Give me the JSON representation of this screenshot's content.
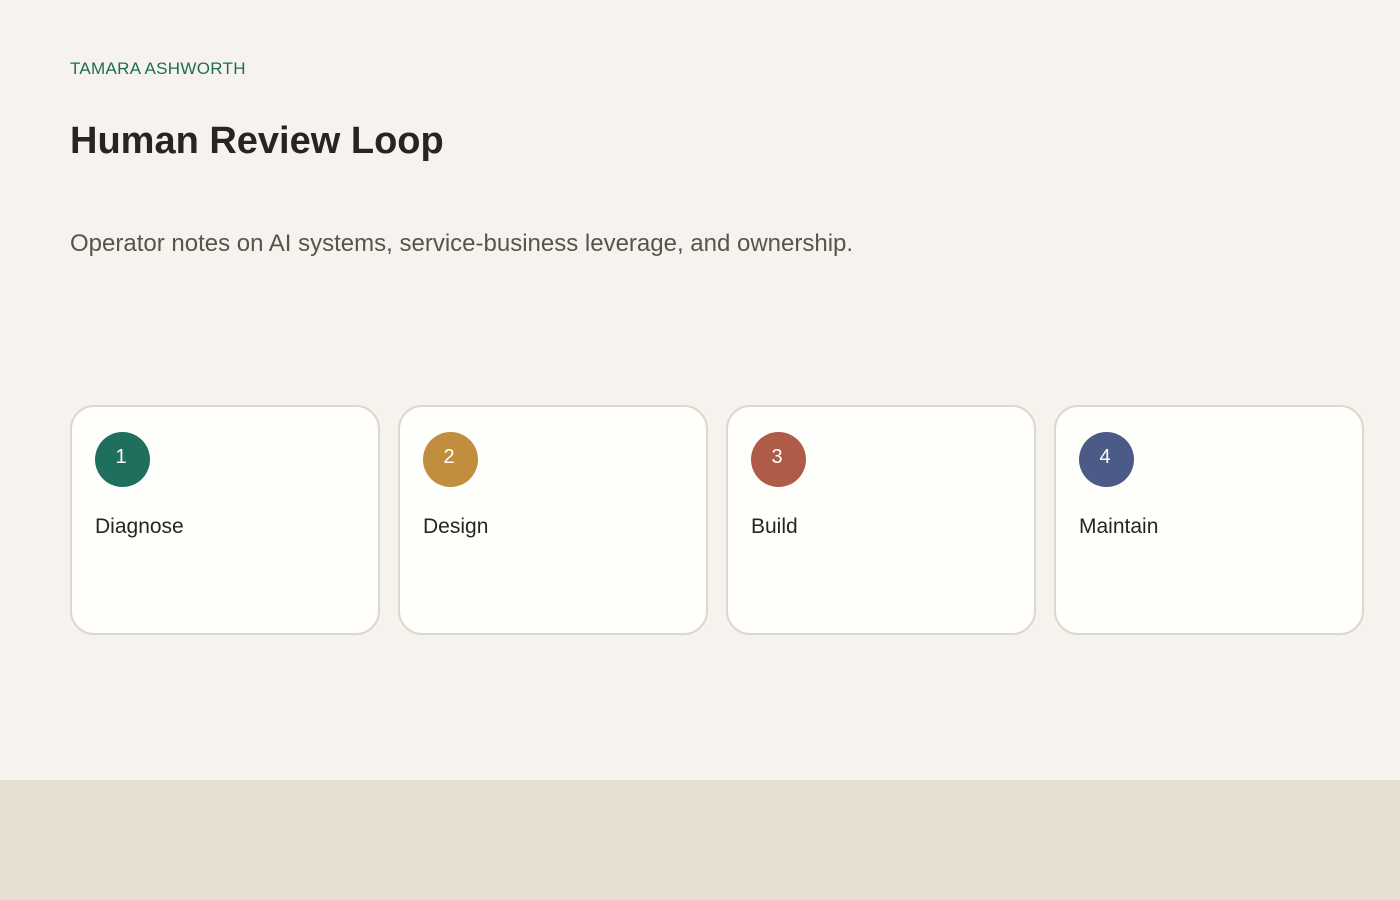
{
  "header": {
    "author": "TAMARA ASHWORTH",
    "title": "Human Review Loop",
    "subtitle": "Operator notes on AI systems, service-business leverage, and ownership."
  },
  "steps": [
    {
      "number": "1",
      "label": "Diagnose",
      "color": "#1f6f5f"
    },
    {
      "number": "2",
      "label": "Design",
      "color": "#c08e3c"
    },
    {
      "number": "3",
      "label": "Build",
      "color": "#ae5b48"
    },
    {
      "number": "4",
      "label": "Maintain",
      "color": "#4c5a88"
    }
  ],
  "colors": {
    "accent": "#1f6b58",
    "background": "#f6f3ee",
    "footer": "#e7e0d2"
  }
}
